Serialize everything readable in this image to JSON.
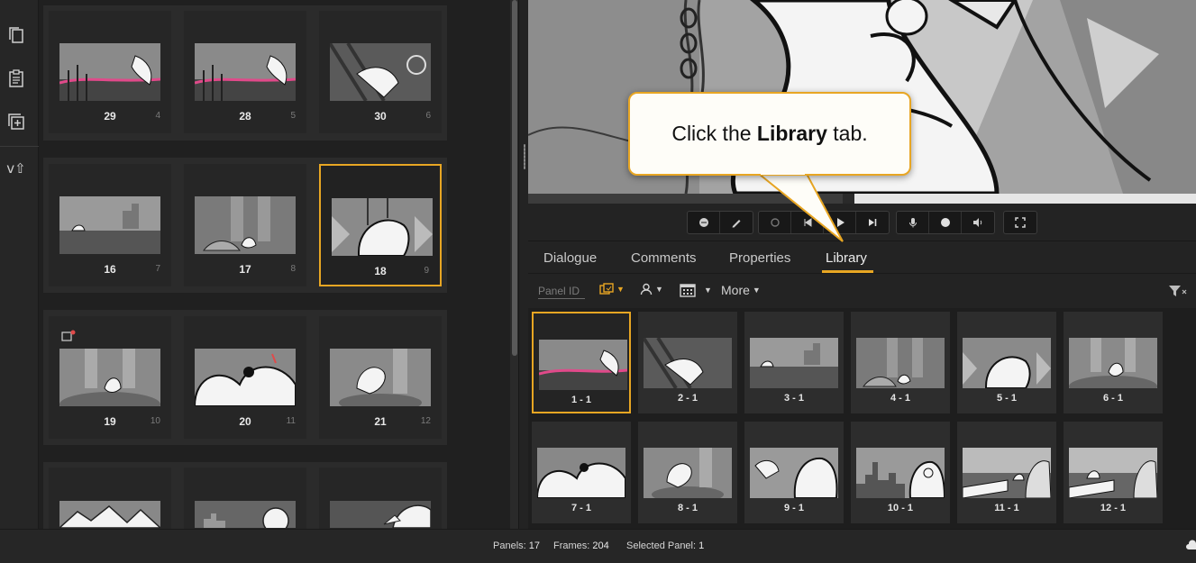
{
  "left_toolbar": {
    "icons": [
      "copy-icon",
      "paste-icon",
      "duplicate-add-icon",
      "version-icon"
    ],
    "version_label": "v⇧"
  },
  "panel_grid": {
    "rows": [
      [
        {
          "number": "29",
          "index": "4",
          "selected": false
        },
        {
          "number": "28",
          "index": "5",
          "selected": false
        },
        {
          "number": "30",
          "index": "6",
          "selected": false
        }
      ],
      [
        {
          "number": "16",
          "index": "7",
          "selected": false
        },
        {
          "number": "17",
          "index": "8",
          "selected": false
        },
        {
          "number": "18",
          "index": "9",
          "selected": true
        }
      ],
      [
        {
          "number": "19",
          "index": "10",
          "selected": false
        },
        {
          "number": "20",
          "index": "11",
          "selected": false
        },
        {
          "number": "21",
          "index": "12",
          "selected": false
        }
      ]
    ]
  },
  "callout": {
    "prefix": "Click the ",
    "bold": "Library",
    "suffix": " tab."
  },
  "tabs": [
    {
      "label": "Dialogue",
      "active": false
    },
    {
      "label": "Comments",
      "active": false
    },
    {
      "label": "Properties",
      "active": false
    },
    {
      "label": "Library",
      "active": true
    }
  ],
  "filter_bar": {
    "panel_id_placeholder": "Panel ID",
    "more_label": "More"
  },
  "library": {
    "items": [
      {
        "label": "1 - 1",
        "selected": true
      },
      {
        "label": "2 - 1",
        "selected": false
      },
      {
        "label": "3 - 1",
        "selected": false
      },
      {
        "label": "4 - 1",
        "selected": false
      },
      {
        "label": "5 - 1",
        "selected": false
      },
      {
        "label": "6 - 1",
        "selected": false
      },
      {
        "label": "7 - 1",
        "selected": false
      },
      {
        "label": "8 - 1",
        "selected": false
      },
      {
        "label": "9 - 1",
        "selected": false
      },
      {
        "label": "10 - 1",
        "selected": false
      },
      {
        "label": "11 - 1",
        "selected": false
      },
      {
        "label": "12 - 1",
        "selected": false
      }
    ]
  },
  "status_bar": {
    "panels_label": "Panels:",
    "panels_value": "17",
    "frames_label": "Frames:",
    "frames_value": "204",
    "selected_label": "Selected Panel:",
    "selected_value": "1"
  },
  "colors": {
    "accent": "#e8a623",
    "background": "#1f1f1f"
  }
}
